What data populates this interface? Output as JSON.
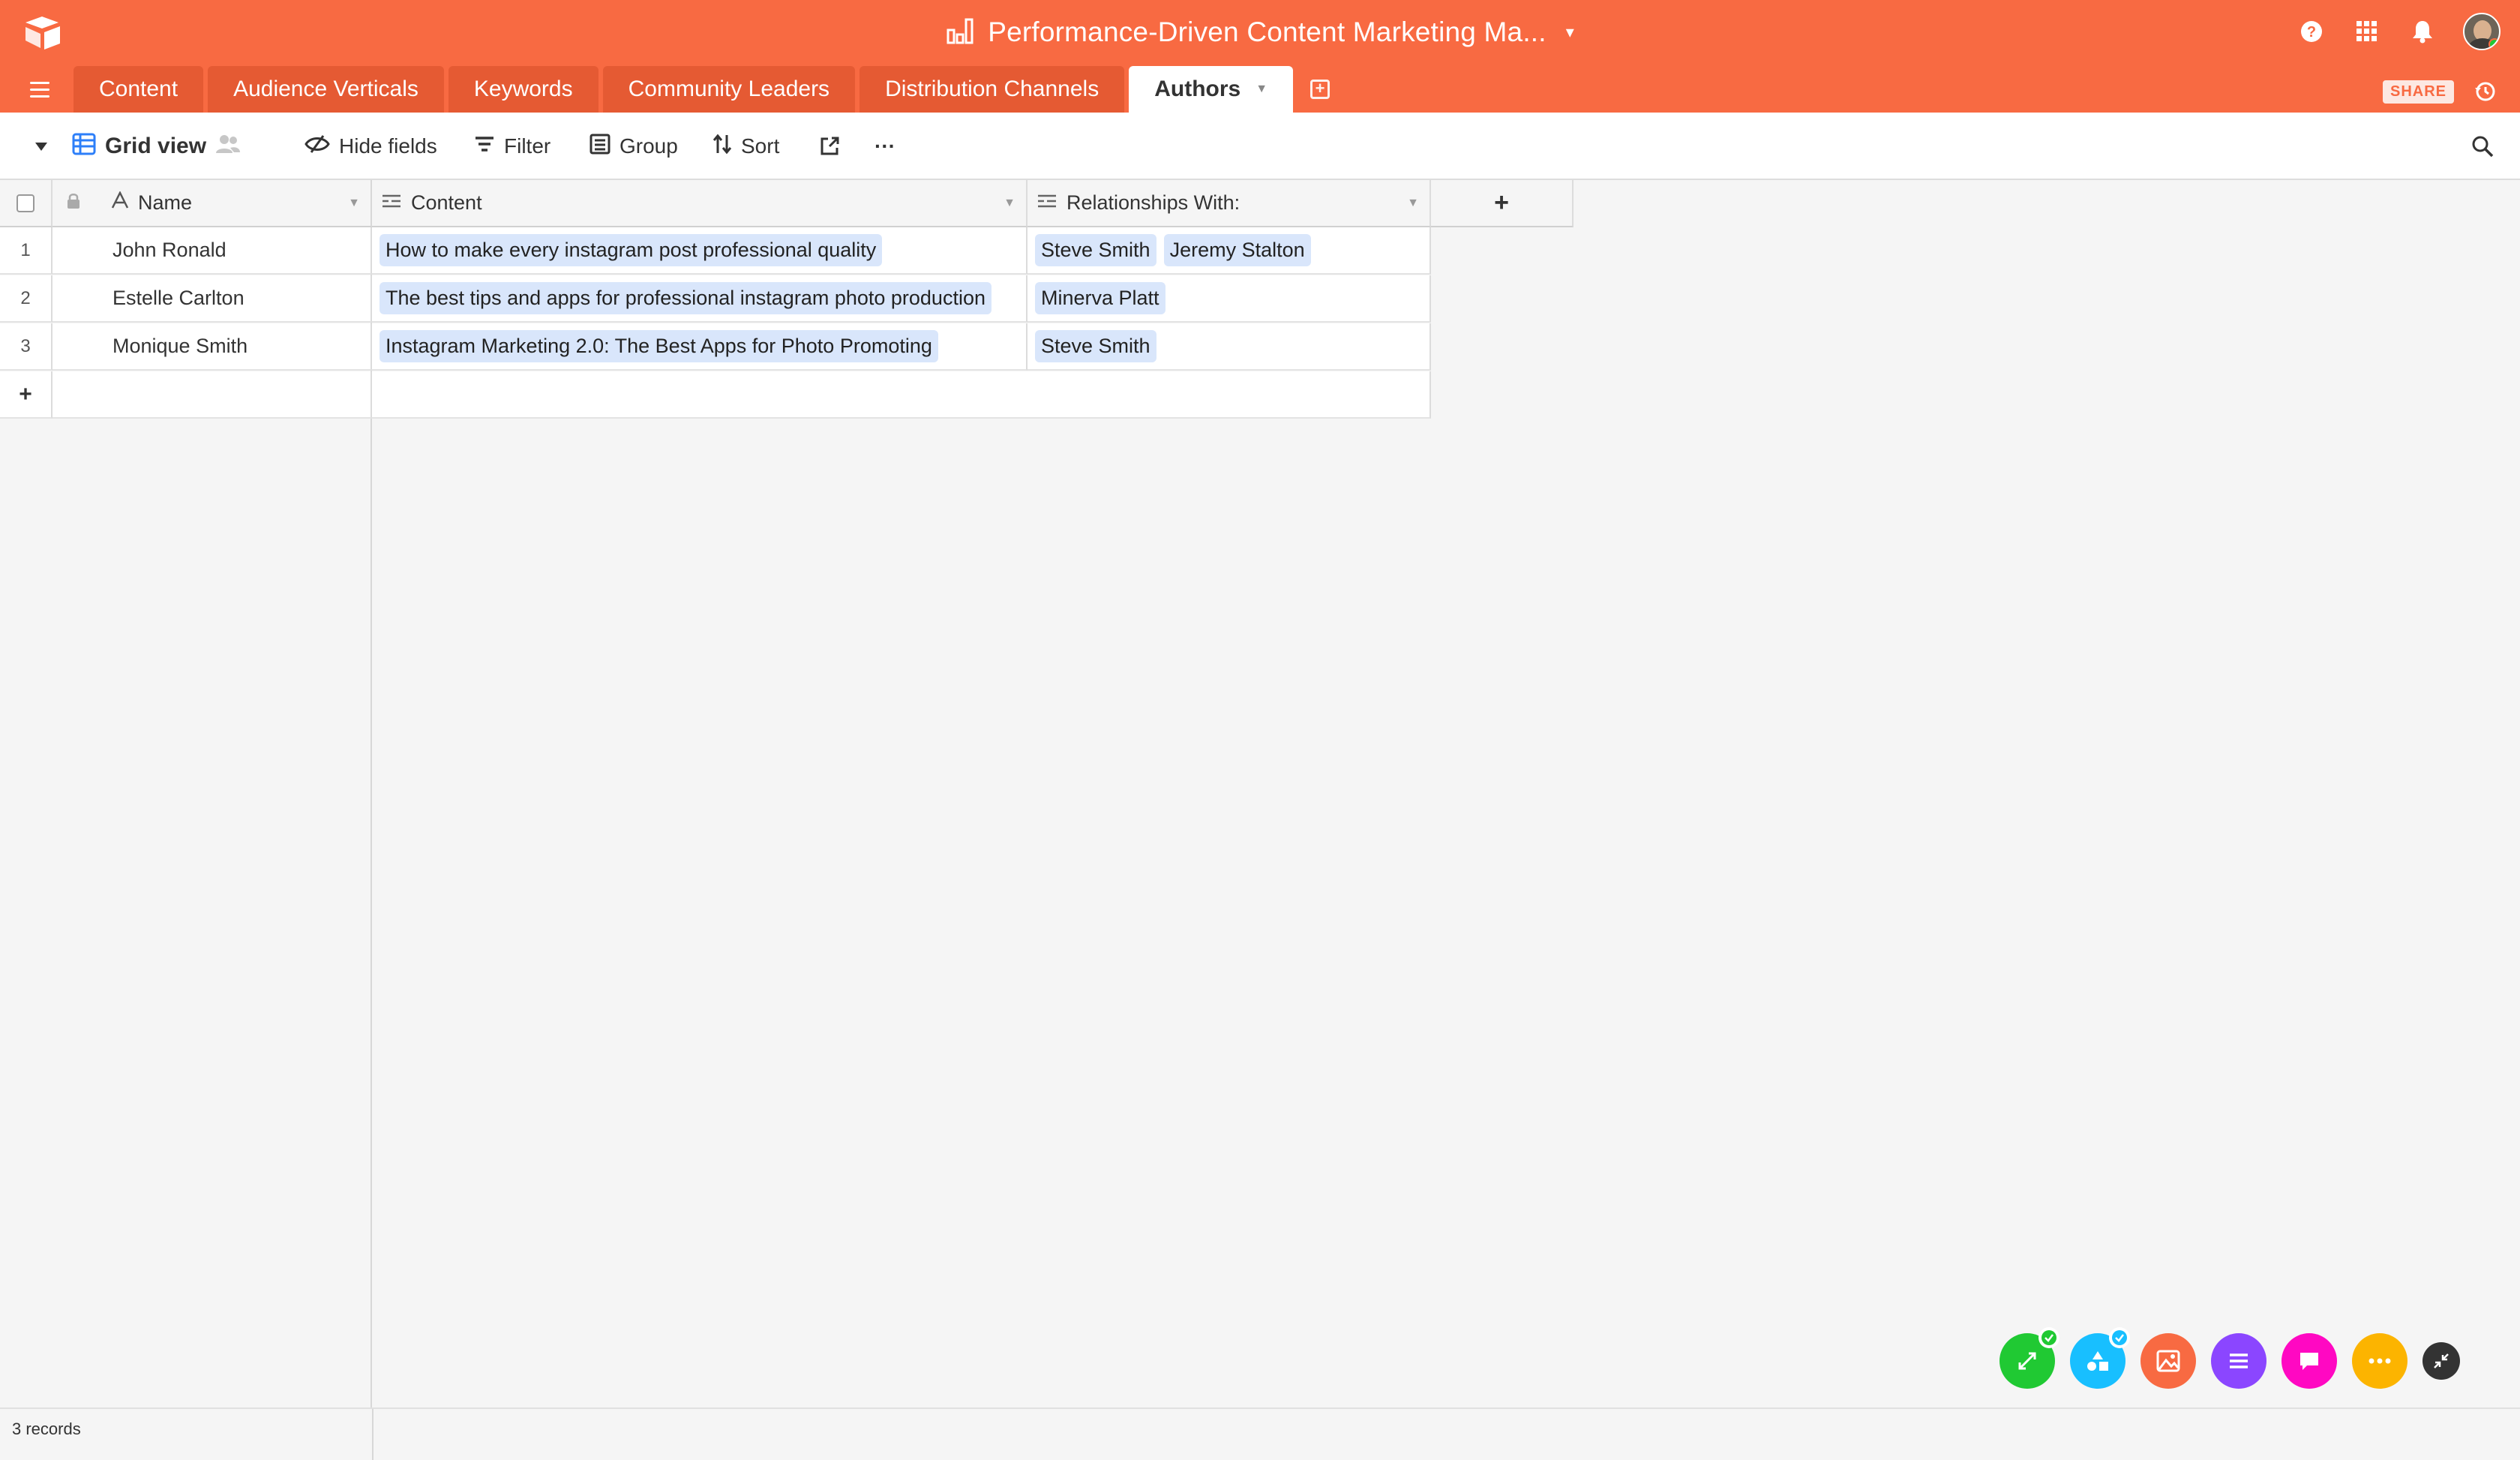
{
  "header": {
    "base_title": "Performance-Driven Content Marketing Ma...",
    "share_label": "SHARE",
    "brand_color": "#f86a42"
  },
  "tabs": [
    {
      "label": "Content"
    },
    {
      "label": "Audience Verticals"
    },
    {
      "label": "Keywords"
    },
    {
      "label": "Community Leaders"
    },
    {
      "label": "Distribution Channels"
    },
    {
      "label": "Authors",
      "active": true
    }
  ],
  "toolbar": {
    "view_name": "Grid view",
    "hide_fields": "Hide fields",
    "filter": "Filter",
    "group": "Group",
    "sort": "Sort",
    "more": "···"
  },
  "grid": {
    "columns": {
      "name": "Name",
      "content": "Content",
      "relationships": "Relationships With:"
    },
    "add_column": "+",
    "add_row": "+",
    "rows": [
      {
        "num": "1",
        "name": "John Ronald",
        "content": "How to make every instagram post professional quality",
        "rel1": "Steve Smith",
        "rel2": "Jeremy Stalton"
      },
      {
        "num": "2",
        "name": "Estelle Carlton",
        "content": "The best tips and apps for professional instagram photo production",
        "rel1": "Minerva Platt",
        "rel2": ""
      },
      {
        "num": "3",
        "name": "Monique Smith",
        "content": "Instagram Marketing 2.0: The Best Apps for Photo Promoting",
        "rel1": "Steve Smith",
        "rel2": ""
      }
    ]
  },
  "footer": {
    "records": "3 records"
  },
  "dock": {
    "colors": [
      "#20c933",
      "#18bfff",
      "#f86a42",
      "#8b46ff",
      "#ff08c2",
      "#fcb400",
      "#333333"
    ]
  }
}
